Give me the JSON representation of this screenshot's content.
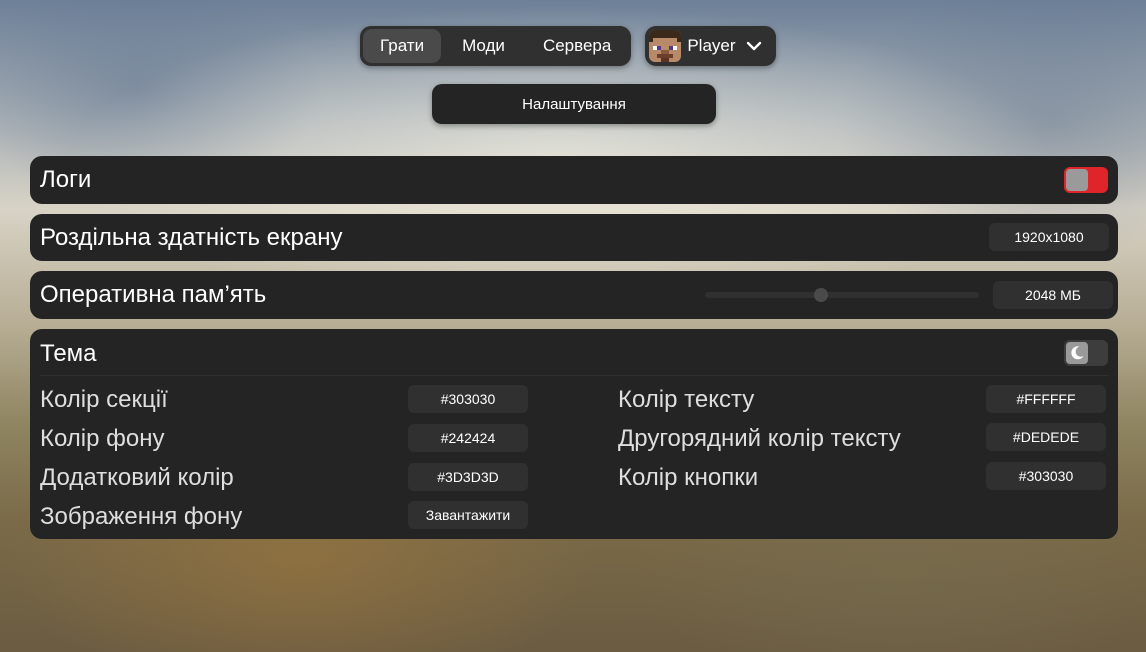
{
  "nav": {
    "tabs": [
      {
        "label": "Грати",
        "active": true
      },
      {
        "label": "Моди",
        "active": false
      },
      {
        "label": "Сервера",
        "active": false
      }
    ],
    "player_name": "Player",
    "player_icon": "chevron-down-icon"
  },
  "settings_button": "Налаштування",
  "logs": {
    "label": "Логи",
    "enabled": true,
    "accent": "#E0252A"
  },
  "resolution": {
    "label": "Роздільна здатність екрану",
    "value": "1920x1080"
  },
  "memory": {
    "label": "Оперативна пам’ять",
    "value": "2048 МБ",
    "slider_fraction": 0.42
  },
  "theme": {
    "label": "Тема",
    "toggle_icon": "moon-icon",
    "left": [
      {
        "label": "Колір секції",
        "value": "#303030"
      },
      {
        "label": "Колір фону",
        "value": "#242424"
      },
      {
        "label": "Додатковий колір",
        "value": "#3D3D3D"
      },
      {
        "label": "Зображення фону",
        "value": "Завантажити"
      }
    ],
    "right": [
      {
        "label": "Колір тексту",
        "value": "#FFFFFF"
      },
      {
        "label": "Другорядний колір тексту",
        "value": "#DEDEDE"
      },
      {
        "label": "Колір кнопки",
        "value": "#303030"
      }
    ]
  },
  "colors": {
    "section": "#303030",
    "background": "#242424",
    "extra": "#3D3D3D",
    "text": "#FFFFFF",
    "text_secondary": "#DEDEDE"
  }
}
